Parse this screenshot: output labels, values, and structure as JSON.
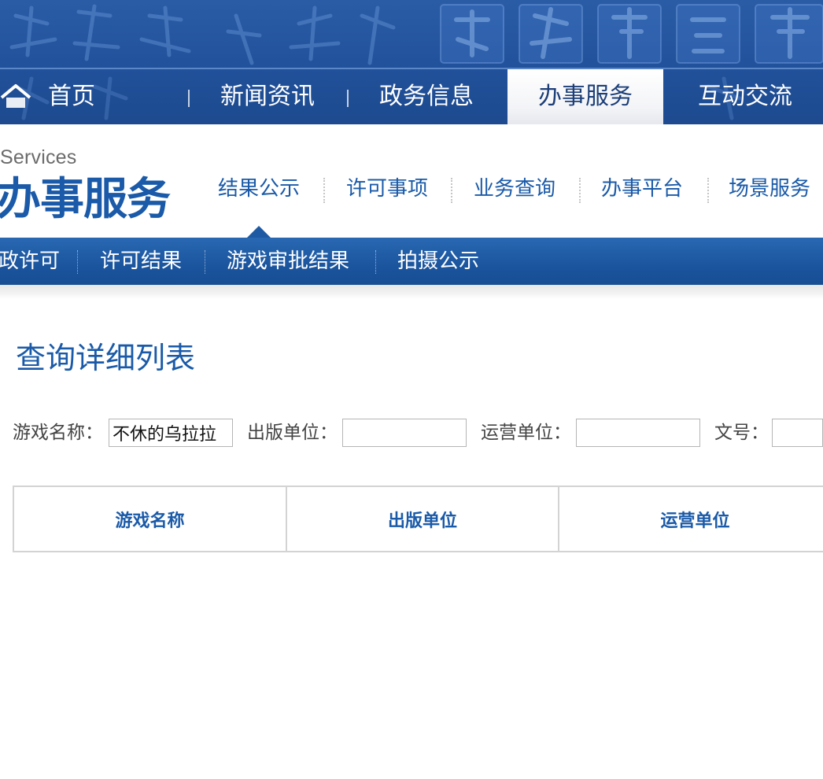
{
  "top_nav": {
    "items": [
      {
        "label": "首页"
      },
      {
        "label": "新闻资讯"
      },
      {
        "label": "政务信息"
      },
      {
        "label": "办事服务"
      },
      {
        "label": "互动交流"
      }
    ],
    "active_index": 3
  },
  "section": {
    "title_en": "Services",
    "title_cn": "办事服务",
    "sub_nav": [
      {
        "label": "结果公示"
      },
      {
        "label": "许可事项"
      },
      {
        "label": "业务查询"
      },
      {
        "label": "办事平台"
      },
      {
        "label": "场景服务"
      }
    ],
    "active_sub_index": 0
  },
  "blue_bar": {
    "items": [
      {
        "label": "政许可"
      },
      {
        "label": "许可结果"
      },
      {
        "label": "游戏审批结果"
      },
      {
        "label": "拍摄公示"
      }
    ]
  },
  "page_title": "查询详细列表",
  "filters": {
    "game_name": {
      "label": "游戏名称：",
      "value": "不休的乌拉拉"
    },
    "publisher": {
      "label": "出版单位：",
      "value": ""
    },
    "operator": {
      "label": "运营单位：",
      "value": ""
    },
    "doc_no": {
      "label": "文号：",
      "value": ""
    }
  },
  "table": {
    "columns": [
      {
        "label": "游戏名称"
      },
      {
        "label": "出版单位"
      },
      {
        "label": "运营单位"
      }
    ],
    "rows": []
  },
  "colors": {
    "brand_blue": "#1a5aa8",
    "banner_blue": "#21519a",
    "bar_blue": "#1b559e"
  }
}
